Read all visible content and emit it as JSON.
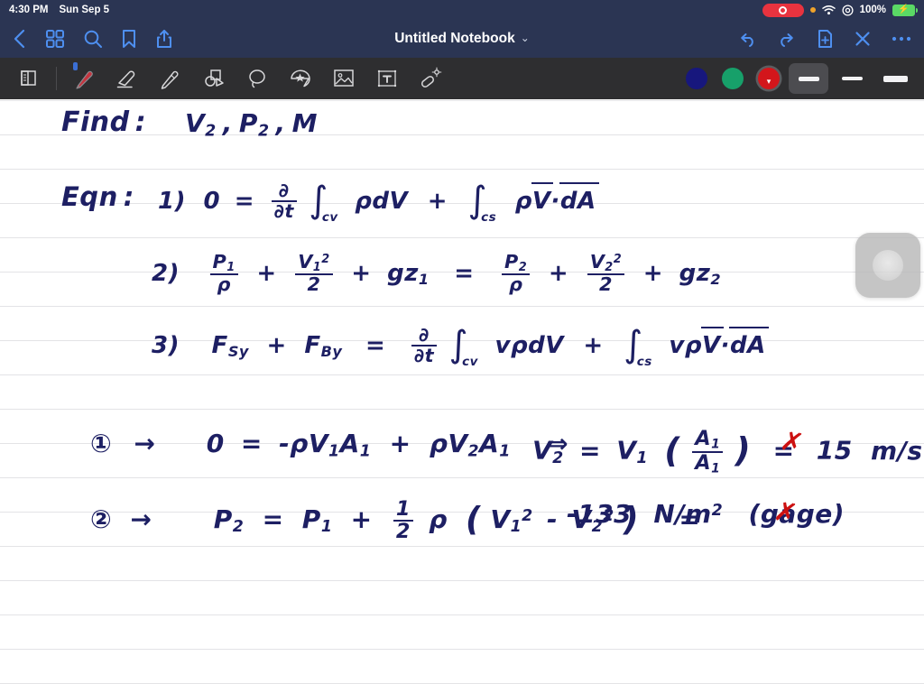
{
  "status_bar": {
    "time": "4:30 PM",
    "date": "Sun Sep 5",
    "battery_percent": "100%",
    "recording_indicator": "screen-recording-active",
    "icons": [
      "orange-dot",
      "wifi-icon",
      "location-icon",
      "battery-charging-icon"
    ]
  },
  "nav_bar": {
    "title": "Untitled Notebook",
    "title_chevron": "⌄",
    "left_icons": [
      {
        "name": "back-button",
        "glyph": "back-chevron-icon"
      },
      {
        "name": "thumbnails-button",
        "glyph": "grid-icon"
      },
      {
        "name": "search-button",
        "glyph": "search-icon"
      },
      {
        "name": "bookmark-button",
        "glyph": "bookmark-icon"
      },
      {
        "name": "share-button",
        "glyph": "share-icon"
      }
    ],
    "right_icons": [
      {
        "name": "undo-button",
        "glyph": "undo-icon"
      },
      {
        "name": "redo-button",
        "glyph": "redo-icon"
      },
      {
        "name": "add-page-button",
        "glyph": "document-plus-icon"
      },
      {
        "name": "close-button",
        "glyph": "close-x-icon"
      },
      {
        "name": "more-button",
        "glyph": "ellipsis-icon"
      }
    ]
  },
  "toolbar": {
    "tools": [
      {
        "name": "page-layout-tool",
        "glyph": "page-split-icon",
        "selected": false
      },
      {
        "name": "pen-tool",
        "glyph": "pen-icon",
        "selected": true
      },
      {
        "name": "eraser-tool",
        "glyph": "eraser-icon",
        "selected": false
      },
      {
        "name": "highlighter-tool",
        "glyph": "highlighter-icon",
        "selected": false
      },
      {
        "name": "shapes-tool",
        "glyph": "shapes-icon",
        "selected": false
      },
      {
        "name": "lasso-tool",
        "glyph": "lasso-icon",
        "selected": false
      },
      {
        "name": "sticker-tool",
        "glyph": "star-sticker-icon",
        "selected": false
      },
      {
        "name": "image-tool",
        "glyph": "image-icon",
        "selected": false
      },
      {
        "name": "text-tool",
        "glyph": "text-box-icon",
        "selected": false
      },
      {
        "name": "laser-pointer-tool",
        "glyph": "magic-wand-icon",
        "selected": false
      }
    ],
    "colors": [
      {
        "name": "color-navy",
        "hex": "#17177d",
        "selected": false
      },
      {
        "name": "color-green",
        "hex": "#17a06a",
        "selected": false
      },
      {
        "name": "color-red",
        "hex": "#d3161b",
        "selected": true
      }
    ],
    "stroke_widths": [
      {
        "name": "stroke-thin",
        "px": 5,
        "selected": true
      },
      {
        "name": "stroke-medium",
        "px": 4,
        "selected": false
      },
      {
        "name": "stroke-thick",
        "px": 7,
        "selected": false
      }
    ]
  },
  "notebook": {
    "ink_color": "#1d1f63",
    "accent_mark_color": "#cc1111",
    "rule_color": "#e3e3e6",
    "lines": [
      {
        "id": "find-line",
        "text": "Find :  V₂ , P₂ , M"
      },
      {
        "id": "eqn-label-line",
        "text": "Eqn :  1) 0 = ∂/∂t ∫cv ρ dV + ∫cs ρ V⃗·dA⃗"
      },
      {
        "id": "eqn-2-line",
        "text": "2)  P₁/ρ + V₁²/2 + gz₁ = P₂/ρ + V₂²/2 + gz₂"
      },
      {
        "id": "eqn-3-line",
        "text": "3)  F_Sy + F_By = ∂/∂t ∫cv v ρ dV + ∫cs v ρ V⃗·dA⃗"
      },
      {
        "id": "result-1-line",
        "text": "① →  0 = -ρV₁A₁ + ρV₂A₁  ⇒   V₂ = V₁ (A₁/A₁) = 15 m/s"
      },
      {
        "id": "result-2-line",
        "text": "② →  P₂ = P₁ + ½ρ (V₁² - V₂²)  =  -133 N/m² (gage)"
      }
    ],
    "labels": {
      "find": "Find",
      "eqn": "Eqn",
      "colon": ":",
      "v2": "V",
      "p2": "P",
      "m": "M",
      "sub2": "2",
      "sub1": "1",
      "comma": ",",
      "num1": "1)",
      "num2": "2)",
      "num3": "3)",
      "zero": "0",
      "equals": "=",
      "plus": "+",
      "minus": "-",
      "rho": "ρ",
      "dV": "dV",
      "dA": "dA",
      "V": "V",
      "partial": "∂",
      "partial_t": "∂t",
      "cv": "cv",
      "cs": "cs",
      "integral": "∫",
      "g": "g",
      "z1": "gz",
      "F_S": "F",
      "F_S_sub": "Sy",
      "F_B": "F",
      "F_B_sub": "By",
      "v_small": "v",
      "circle1": "①",
      "circle2": "②",
      "arrow": "→",
      "implies": "⇒",
      "A": "A",
      "result_v2": "15",
      "result_v2_unit": "m/s",
      "result_p2": "-133",
      "result_p2_unit": "N/m",
      "gage": "(gage)",
      "half_n": "1",
      "half_d": "2",
      "two": "2",
      "check_mark": "✗"
    }
  },
  "floating_widget": {
    "name": "assistive-touch-overlay"
  }
}
